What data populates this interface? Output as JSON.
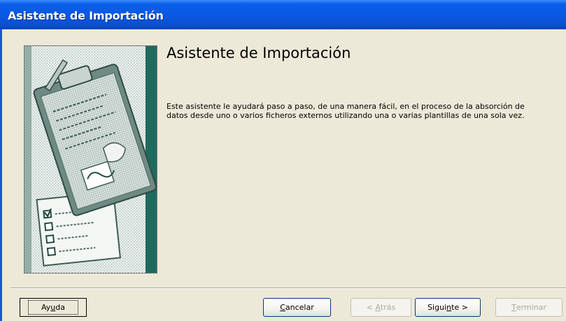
{
  "window": {
    "title": "Asistente de Importación"
  },
  "main": {
    "heading": "Asistente de Importación",
    "description": "Este asistente le ayudará paso a paso, de una manera fácil, en el proceso de la absorción de datos desde uno o varios ficheros externos utilizando una o varias plantillas de una sola vez."
  },
  "buttons": {
    "help": {
      "label": "Ayuda",
      "accel": "u"
    },
    "cancel": {
      "label": "Cancelar",
      "accel": "C"
    },
    "back": {
      "label": "< Atrás",
      "accel": "A",
      "enabled": false
    },
    "next": {
      "label": "Siguiente >",
      "accel": "n"
    },
    "finish": {
      "label": "Terminar",
      "accel": "T",
      "enabled": false
    }
  },
  "illustration": {
    "name": "clipboard-checklist-illustration"
  },
  "colors": {
    "titlebar": "#0a5ee8",
    "dialog_bg": "#ece9d8",
    "accent_teal": "#1f6a5e"
  }
}
